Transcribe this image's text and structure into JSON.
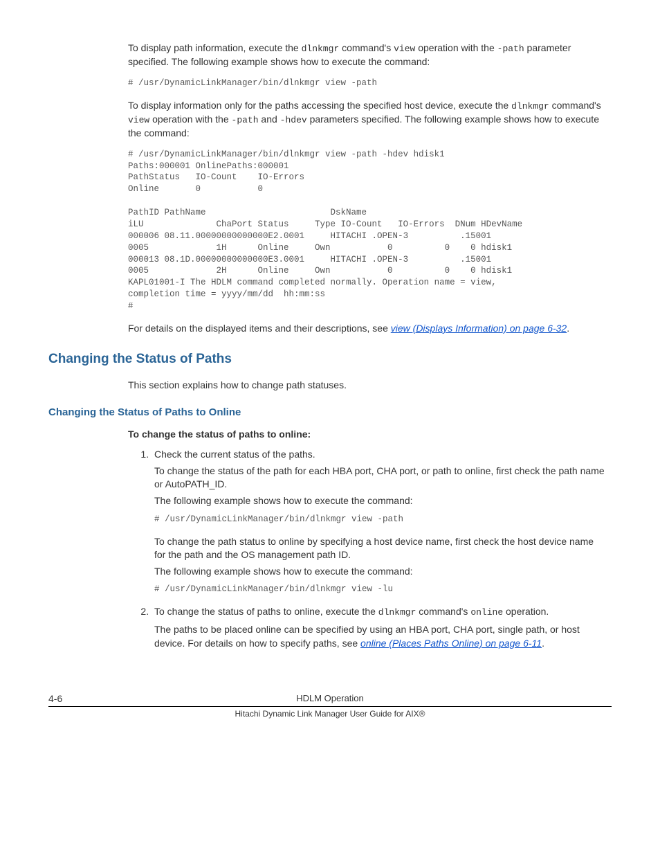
{
  "intro": {
    "p1_a": "To display path information, execute the ",
    "p1_cmd": "dlnkmgr",
    "p1_b": " command's ",
    "p1_view": "view",
    "p1_c": " operation with the ",
    "p1_path": "-path",
    "p1_d": " parameter specified. The following example shows how to execute the command:",
    "code1": "# /usr/DynamicLinkManager/bin/dlnkmgr view -path",
    "p2_a": "To display information only for the paths accessing the specified host device, execute the ",
    "p2_cmd": "dlnkmgr",
    "p2_b": " command's ",
    "p2_view": "view",
    "p2_c": " operation with the ",
    "p2_path": "-path",
    "p2_d": " and ",
    "p2_hdev": "-hdev",
    "p2_e": " parameters specified. The following example shows how to execute the command:",
    "code2": "# /usr/DynamicLinkManager/bin/dlnkmgr view -path -hdev hdisk1\nPaths:000001 OnlinePaths:000001\nPathStatus   IO-Count    IO-Errors\nOnline       0           0\n\nPathID PathName                        DskName\niLU              ChaPort Status     Type IO-Count   IO-Errors  DNum HDevName\n000006 08.11.00000000000000E2.0001     HITACHI .OPEN-3          .15001\n0005             1H      Online     Own           0          0    0 hdisk1\n000013 08.1D.00000000000000E3.0001     HITACHI .OPEN-3          .15001\n0005             2H      Online     Own           0          0    0 hdisk1\nKAPL01001-I The HDLM command completed normally. Operation name = view,\ncompletion time = yyyy/mm/dd  hh:mm:ss\n#",
    "p3_a": "For details on the displayed items and their descriptions, see ",
    "p3_link": "view (Displays Information) on page 6-32",
    "p3_b": "."
  },
  "h2": "Changing the Status of Paths",
  "p4": "This section explains how to change path statuses.",
  "h3": "Changing the Status of Paths to Online",
  "bold_intro": "To change the status of paths to online:",
  "steps": {
    "s1_a": "Check the current status of the paths.",
    "s1_b": "To change the status of the path for each HBA port, CHA port, or path to online, first check the path name or AutoPATH_ID.",
    "s1_c": "The following example shows how to execute the command:",
    "s1_code1": "# /usr/DynamicLinkManager/bin/dlnkmgr view -path",
    "s1_d": "To change the path status to online by specifying a host device name, first check the host device name for the path and the OS management path ID.",
    "s1_e": "The following example shows how to execute the command:",
    "s1_code2": "# /usr/DynamicLinkManager/bin/dlnkmgr view -lu",
    "s2_a": "To change the status of paths to online, execute the ",
    "s2_cmd": "dlnkmgr",
    "s2_b": " command's ",
    "s2_online": "online",
    "s2_c": " operation.",
    "s2_d": "The paths to be placed online can be specified by using an HBA port, CHA port, single path, or host device. For details on how to specify paths, see ",
    "s2_link": "online (Places Paths Online) on page 6-11",
    "s2_e": "."
  },
  "footer": {
    "page": "4-6",
    "title": "HDLM Operation",
    "sub": "Hitachi Dynamic Link Manager User Guide for AIX®"
  }
}
